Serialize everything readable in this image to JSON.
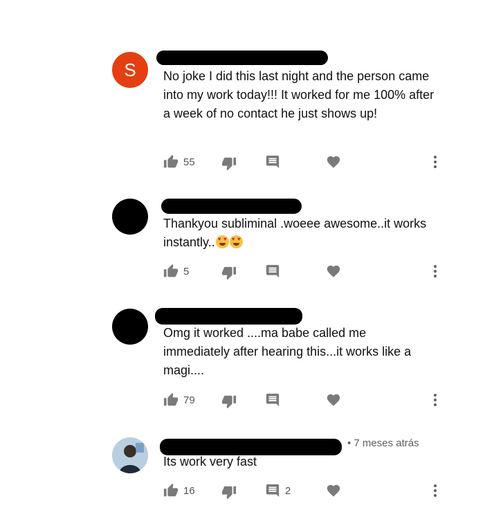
{
  "colors": {
    "avatar_s": "#e43f12",
    "redaction": "#000000",
    "icon": "#7a7a7a"
  },
  "comments": [
    {
      "avatar_letter": "S",
      "text": "No joke I did this last night and the person came into my work today!!! It worked for me 100% after a week of no contact he just shows up!",
      "likes": "55",
      "replies": ""
    },
    {
      "text": "Thankyou subliminal .woeee awesome..it works instantly..",
      "emoji": [
        "smiling-face-with-heart-eyes",
        "smiling-face-with-heart-eyes"
      ],
      "likes": "5",
      "replies": ""
    },
    {
      "text": "Omg it worked ....ma babe called me immediately after  hearing this...it works like a magi....",
      "likes": "79",
      "replies": ""
    },
    {
      "timestamp": "• 7 meses atrás",
      "text": "Its work very fast",
      "likes": "16",
      "replies": "2"
    }
  ]
}
